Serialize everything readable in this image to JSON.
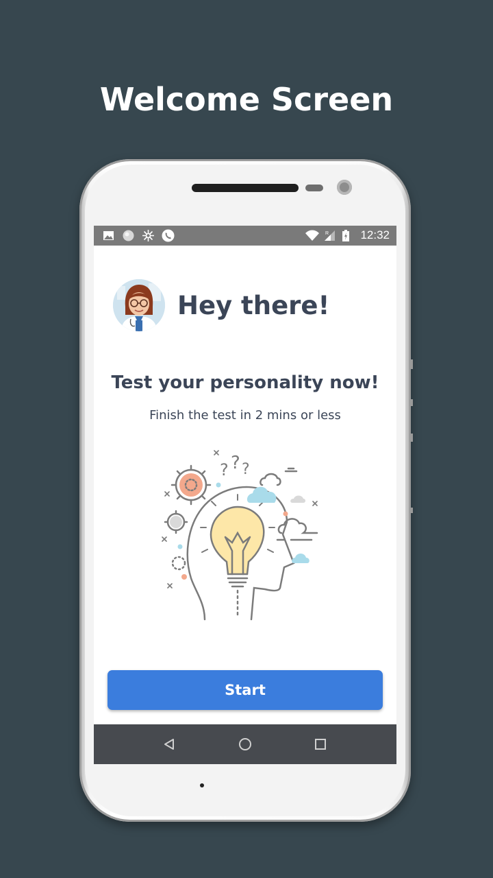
{
  "header": {
    "title": "Welcome Screen"
  },
  "status_bar": {
    "time": "12:32",
    "left_icons": [
      "image-icon",
      "circle-icon",
      "sync-icon",
      "phone-icon"
    ],
    "right_icons": [
      "wifi-icon",
      "signal-icon",
      "battery-charging-icon"
    ]
  },
  "main": {
    "greeting": "Hey there!",
    "title": "Test your personality now!",
    "subtitle": "Finish the test in 2 mins or less",
    "start_label": "Start"
  },
  "nav_bar": {
    "items": [
      "back-icon",
      "home-icon",
      "recents-icon"
    ]
  },
  "colors": {
    "background": "#37474f",
    "accent": "#3b7ddd",
    "text": "#3b4557",
    "status_bar": "#7a7a7a",
    "nav_bar": "#474a4f"
  }
}
